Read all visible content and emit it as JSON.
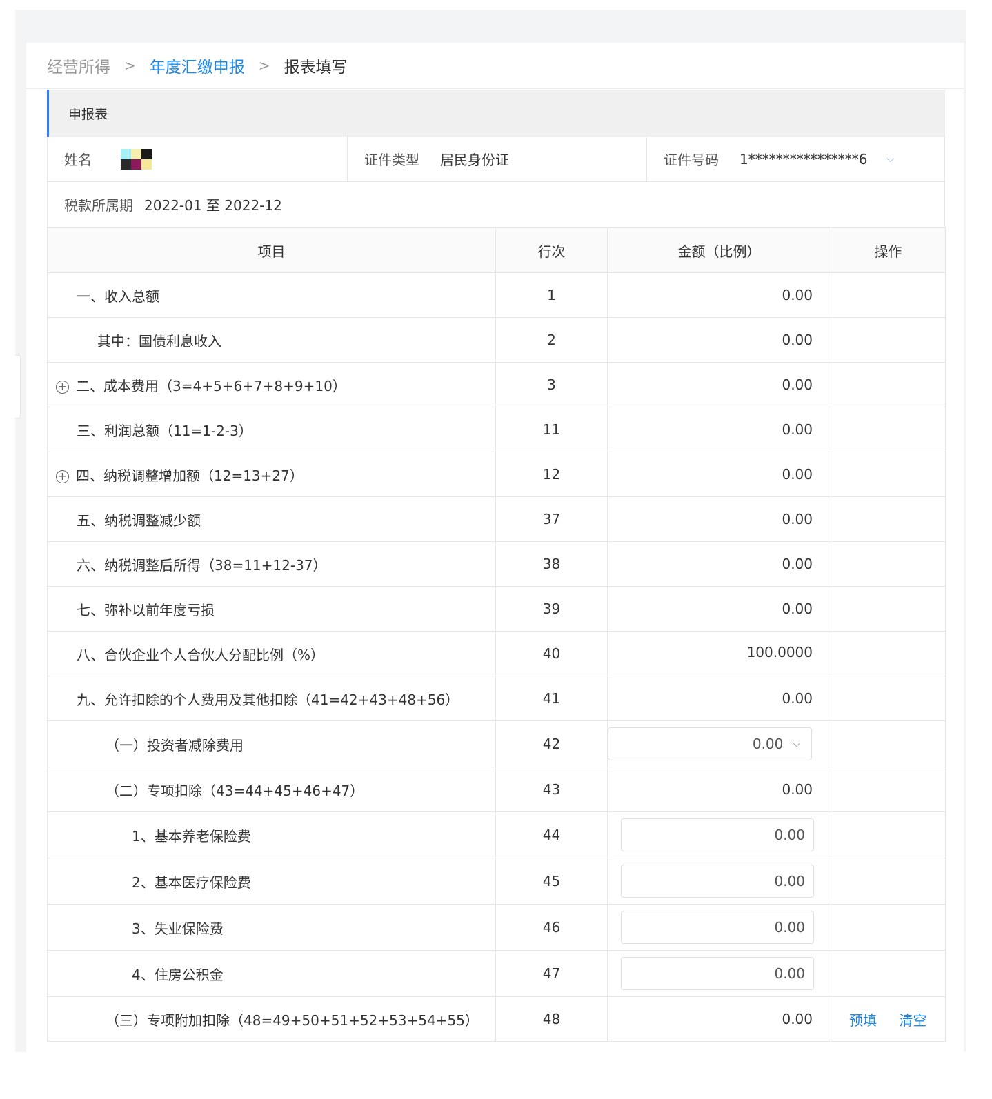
{
  "breadcrumb": {
    "item1": "经营所得",
    "item2": "年度汇缴申报",
    "item3": "报表填写",
    "separator": ">"
  },
  "section_title": "申报表",
  "info": {
    "name_label": "姓名",
    "id_type_label": "证件类型",
    "id_type_value": "居民身份证",
    "id_no_label": "证件号码",
    "id_no_value": "1****************6",
    "period_label": "税款所属期",
    "period_value": "2022-01 至 2022-12"
  },
  "table": {
    "headers": {
      "item": "项目",
      "row": "行次",
      "amount": "金额（比例）",
      "ops": "操作"
    },
    "rows": [
      {
        "item": "一、收入总额",
        "row": "1",
        "amount": "0.00"
      },
      {
        "item": "其中：国债利息收入",
        "row": "2",
        "amount": "0.00"
      },
      {
        "item": "二、成本费用（3=4+5+6+7+8+9+10）",
        "row": "3",
        "amount": "0.00"
      },
      {
        "item": "三、利润总额（11=1-2-3）",
        "row": "11",
        "amount": "0.00"
      },
      {
        "item": "四、纳税调整增加额（12=13+27）",
        "row": "12",
        "amount": "0.00"
      },
      {
        "item": "五、纳税调整减少额",
        "row": "37",
        "amount": "0.00"
      },
      {
        "item": "六、纳税调整后所得（38=11+12-37）",
        "row": "38",
        "amount": "0.00"
      },
      {
        "item": "七、弥补以前年度亏损",
        "row": "39",
        "amount": "0.00"
      },
      {
        "item": "八、合伙企业个人合伙人分配比例（%）",
        "row": "40",
        "amount": "100.0000"
      },
      {
        "item": "九、允许扣除的个人费用及其他扣除（41=42+43+48+56）",
        "row": "41",
        "amount": "0.00"
      },
      {
        "item": "（一）投资者减除费用",
        "row": "42",
        "amount": "0.00"
      },
      {
        "item": "（二）专项扣除（43=44+45+46+47）",
        "row": "43",
        "amount": "0.00"
      },
      {
        "item": "1、基本养老保险费",
        "row": "44",
        "amount": "0.00"
      },
      {
        "item": "2、基本医疗保险费",
        "row": "45",
        "amount": "0.00"
      },
      {
        "item": "3、失业保险费",
        "row": "46",
        "amount": "0.00"
      },
      {
        "item": "4、住房公积金",
        "row": "47",
        "amount": "0.00"
      },
      {
        "item": "（三）专项附加扣除（48=49+50+51+52+53+54+55）",
        "row": "48",
        "amount": "0.00"
      }
    ],
    "ops": {
      "prefill": "预填",
      "clear": "清空"
    }
  },
  "icons": {
    "expand": "plus-circle-icon",
    "select_arrow": "chevron-down-icon",
    "id_toggle": "chevron-down-icon"
  },
  "colors": {
    "accent": "#1e88e5",
    "section_border": "#2d7ff9"
  }
}
